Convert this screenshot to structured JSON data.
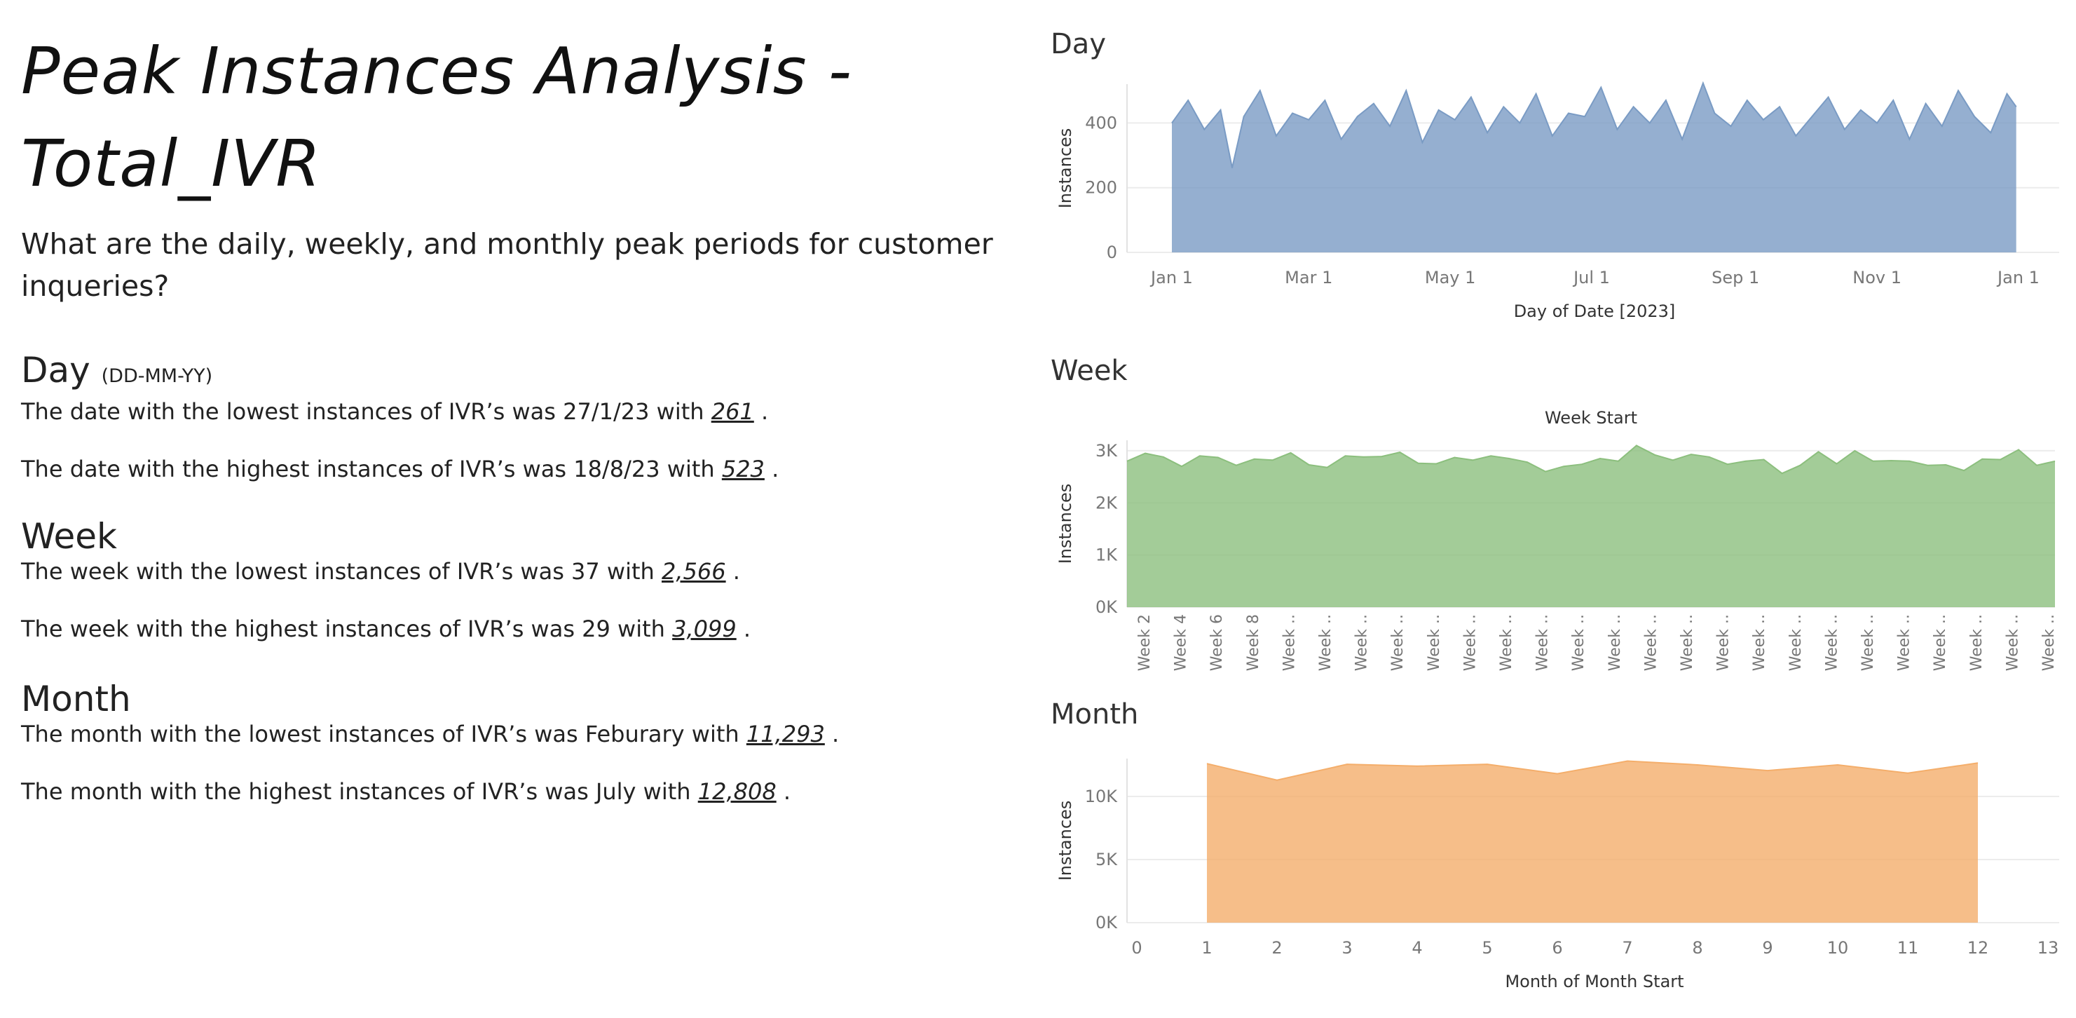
{
  "left": {
    "title_line1": "Peak Instances Analysis -",
    "title_line2": "Total_IVR",
    "question": "What are the daily, weekly, and monthly peak periods for customer inqueries?",
    "day": {
      "heading": "Day",
      "heading_note": "(DD-MM-YY)",
      "low_text": "The date with the lowest instances of IVR’s was 27/1/23 with",
      "low_value": "261",
      "high_text": "The date with the highest instances of IVR’s was 18/8/23 with",
      "high_value": "523"
    },
    "week": {
      "heading": "Week",
      "low_text": "The week with the lowest instances of IVR’s was 37 with",
      "low_value": "2,566",
      "high_text": "The week with the highest instances of IVR’s was 29 with",
      "high_value": "3,099"
    },
    "month": {
      "heading": "Month",
      "low_text": "The month with the lowest instances of IVR’s was Feburary with",
      "low_value": "11,293",
      "high_text": "The month with the highest instances of IVR’s was July with",
      "high_value": "12,808"
    },
    "period": "."
  },
  "chart_data": [
    {
      "type": "area",
      "title": "Day",
      "xlabel": "Day of Date [2023]",
      "ylabel": "Instances",
      "color": "#7a9bc4",
      "ylim": [
        0,
        520
      ],
      "yticks": [
        0,
        200,
        400
      ],
      "ytick_labels": [
        "0",
        "200",
        "400"
      ],
      "xtick_labels": [
        "Jan 1",
        "Mar 1",
        "May 1",
        "Jul 1",
        "Sep 1",
        "Nov 1",
        "Jan 1"
      ],
      "date_range": [
        "2023-01-01",
        "2023-12-31"
      ],
      "x": [
        "2023-01-01",
        "2023-01-08",
        "2023-01-15",
        "2023-01-22",
        "2023-01-27",
        "2023-02-01",
        "2023-02-08",
        "2023-02-15",
        "2023-02-22",
        "2023-03-01",
        "2023-03-08",
        "2023-03-15",
        "2023-03-22",
        "2023-03-29",
        "2023-04-05",
        "2023-04-12",
        "2023-04-19",
        "2023-04-26",
        "2023-05-03",
        "2023-05-10",
        "2023-05-17",
        "2023-05-24",
        "2023-05-31",
        "2023-06-07",
        "2023-06-14",
        "2023-06-21",
        "2023-06-28",
        "2023-07-05",
        "2023-07-12",
        "2023-07-19",
        "2023-07-26",
        "2023-08-02",
        "2023-08-09",
        "2023-08-18",
        "2023-08-23",
        "2023-08-30",
        "2023-09-06",
        "2023-09-13",
        "2023-09-20",
        "2023-09-27",
        "2023-10-04",
        "2023-10-11",
        "2023-10-18",
        "2023-10-25",
        "2023-11-01",
        "2023-11-08",
        "2023-11-15",
        "2023-11-22",
        "2023-11-29",
        "2023-12-06",
        "2023-12-13",
        "2023-12-20",
        "2023-12-27",
        "2023-12-31"
      ],
      "values": [
        400,
        470,
        380,
        440,
        261,
        420,
        500,
        360,
        430,
        410,
        470,
        350,
        420,
        460,
        390,
        500,
        340,
        440,
        410,
        480,
        370,
        450,
        400,
        490,
        360,
        430,
        420,
        510,
        380,
        450,
        400,
        470,
        350,
        523,
        430,
        390,
        470,
        410,
        450,
        360,
        420,
        480,
        380,
        440,
        400,
        470,
        350,
        460,
        390,
        500,
        420,
        370,
        490,
        450
      ]
    },
    {
      "type": "area",
      "title": "Week",
      "top_title": "Week Start",
      "ylabel": "Instances",
      "color": "#8cbf7e",
      "ylim": [
        0,
        3200
      ],
      "yticks": [
        0,
        1000,
        2000,
        3000
      ],
      "ytick_labels": [
        "0K",
        "1K",
        "2K",
        "3K"
      ],
      "xtick_labels": [
        "Week 2",
        "Week 4",
        "Week 6",
        "Week 8",
        "Week ..",
        "Week ..",
        "Week ..",
        "Week ..",
        "Week ..",
        "Week ..",
        "Week ..",
        "Week ..",
        "Week ..",
        "Week ..",
        "Week ..",
        "Week ..",
        "Week ..",
        "Week ..",
        "Week ..",
        "Week ..",
        "Week ..",
        "Week ..",
        "Week ..",
        "Week ..",
        "Week ..",
        "Week .."
      ],
      "weeks": [
        1,
        2,
        3,
        4,
        5,
        6,
        7,
        8,
        9,
        10,
        11,
        12,
        13,
        14,
        15,
        16,
        17,
        18,
        19,
        20,
        21,
        22,
        23,
        24,
        25,
        26,
        27,
        28,
        29,
        30,
        31,
        32,
        33,
        34,
        35,
        36,
        37,
        38,
        39,
        40,
        41,
        42,
        43,
        44,
        45,
        46,
        47,
        48,
        49,
        50,
        51,
        52
      ],
      "values": [
        2800,
        2950,
        2880,
        2700,
        2900,
        2870,
        2720,
        2840,
        2820,
        2960,
        2730,
        2680,
        2900,
        2880,
        2890,
        2970,
        2760,
        2750,
        2870,
        2820,
        2900,
        2850,
        2780,
        2600,
        2700,
        2740,
        2850,
        2800,
        3099,
        2920,
        2820,
        2930,
        2880,
        2740,
        2800,
        2830,
        2566,
        2720,
        2980,
        2750,
        3000,
        2800,
        2810,
        2800,
        2720,
        2730,
        2620,
        2840,
        2830,
        3020,
        2720,
        2800
      ]
    },
    {
      "type": "area",
      "title": "Month",
      "xlabel": "Month of Month Start",
      "ylabel": "Instances",
      "color": "#f4ae6b",
      "xlim": [
        0,
        13
      ],
      "ylim": [
        0,
        13000
      ],
      "yticks": [
        0,
        5000,
        10000
      ],
      "ytick_labels": [
        "0K",
        "5K",
        "10K"
      ],
      "xticks": [
        0,
        1,
        2,
        3,
        4,
        5,
        6,
        7,
        8,
        9,
        10,
        11,
        12,
        13
      ],
      "x": [
        1,
        2,
        3,
        4,
        5,
        6,
        7,
        8,
        9,
        10,
        11,
        12
      ],
      "values": [
        12600,
        11293,
        12550,
        12400,
        12550,
        11800,
        12808,
        12500,
        12050,
        12500,
        11850,
        12650
      ]
    }
  ]
}
